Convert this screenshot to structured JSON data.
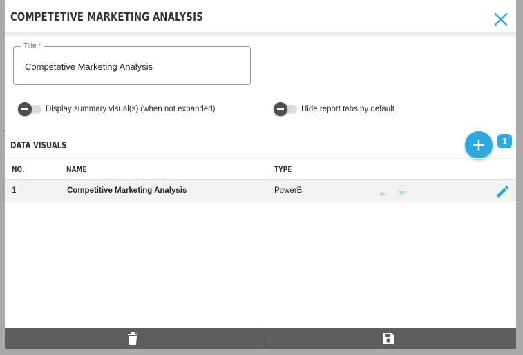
{
  "dialog": {
    "title": "COMPETETIVE MARKETING ANALYSIS"
  },
  "title_field": {
    "label": "Title",
    "required_mark": "*",
    "value": "Competetive Marketing Analysis"
  },
  "toggles": {
    "summary_label": "Display summary visual(s) (when not expanded)",
    "summary_on": false,
    "hide_tabs_label": "Hide report tabs by default",
    "hide_tabs_on": false
  },
  "visuals": {
    "section_title": "DATA VISUALS",
    "count": "1",
    "columns": {
      "no": "NO.",
      "name": "NAME",
      "type": "TYPE"
    },
    "rows": [
      {
        "no": "1",
        "name": "Competitive Marketing Analysis",
        "type": "PowerBi"
      }
    ]
  },
  "icons": {
    "close": "close-icon",
    "add": "plus-icon",
    "move_up": "arrow-up-icon",
    "move_down": "arrow-down-icon",
    "edit": "pencil-icon",
    "delete": "trash-icon",
    "save": "floppy-disk-icon"
  },
  "colors": {
    "accent": "#29abe2",
    "footer": "#5d5d5d",
    "toggle_knob": "#4e4e4e",
    "backdrop": "#a9a9a9"
  }
}
